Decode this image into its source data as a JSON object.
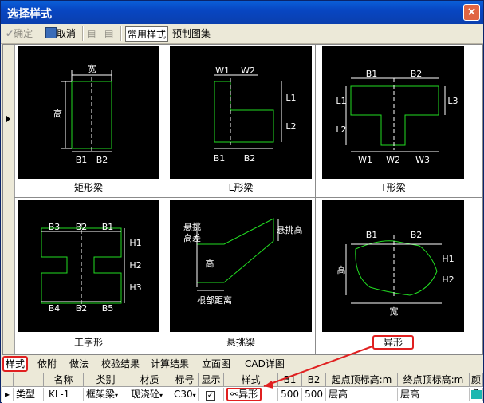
{
  "window": {
    "title": "选择样式",
    "close": "×"
  },
  "toolbar": {
    "confirm": "确定",
    "cancel": "取消",
    "common": "常用样式",
    "preset": "预制图集"
  },
  "cards": [
    {
      "caption": "矩形梁"
    },
    {
      "caption": "L形梁"
    },
    {
      "caption": "T形梁"
    },
    {
      "caption": "工字形"
    },
    {
      "caption": "悬挑梁"
    },
    {
      "caption": "异形"
    }
  ],
  "labels": {
    "rect": {
      "w": "宽",
      "h": "高",
      "b1": "B1",
      "b2": "B2"
    },
    "l": {
      "w1": "W1",
      "w2": "W2",
      "l1": "L1",
      "l2": "L2",
      "b1": "B1",
      "b2": "B2"
    },
    "t": {
      "b1": "B1",
      "b2": "B2",
      "l1": "L1",
      "l2": "L2",
      "l3": "L3",
      "w1": "W1",
      "w2": "W2",
      "w3": "W3"
    },
    "i": {
      "b3": "B3",
      "b2": "B2",
      "b1": "B1",
      "b4": "B4",
      "b2b": "B2",
      "b5": "B5",
      "h1": "H1",
      "h2": "H2",
      "h3": "H3"
    },
    "cant": {
      "diff1": "悬挑",
      "diff2": "高差",
      "high": "悬挑高",
      "h": "高",
      "root": "根部距离"
    },
    "irr": {
      "b1": "B1",
      "b2": "B2",
      "h": "高",
      "h1": "H1",
      "h2": "H2",
      "w": "宽"
    }
  },
  "tabs": [
    "样式",
    "依附",
    "做法",
    "校验结果",
    "计算结果",
    "立面图",
    "CAD详图"
  ],
  "table": {
    "headers": [
      "名称",
      "类别",
      "材质",
      "标号",
      "显示",
      "样式",
      "B1",
      "B2",
      "起点顶标高:m",
      "终点顶标高:m",
      "颜色"
    ],
    "row": {
      "type": "类型",
      "name": "KL-1",
      "category": "框架梁",
      "material": "现浇砼",
      "grade": "C30",
      "style": "异形",
      "b1": "500",
      "b2": "500",
      "start": "层高",
      "end": "层高"
    }
  }
}
